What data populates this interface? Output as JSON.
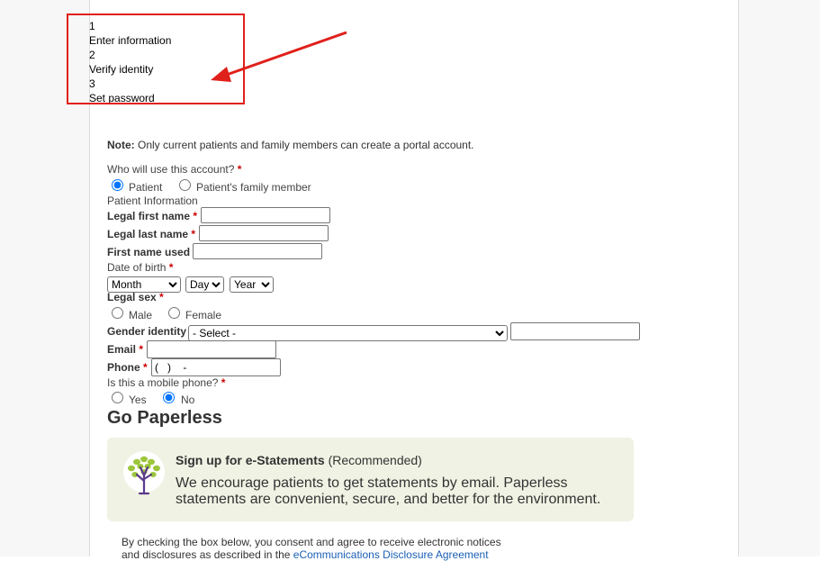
{
  "steps": [
    {
      "number": "1",
      "label": "Enter information"
    },
    {
      "number": "2",
      "label": "Verify identity"
    },
    {
      "number": "3",
      "label": "Set password"
    }
  ],
  "note": {
    "prefix": "Note:",
    "text": " Only current patients and family members can create a portal account."
  },
  "account_user": {
    "question": "Who will use this account?",
    "required_mark": "*",
    "options": [
      "Patient",
      "Patient's family member"
    ],
    "selected": "Patient"
  },
  "patient_info": {
    "heading": "Patient Information",
    "first_name_label": "Legal first name",
    "last_name_label": "Legal last name",
    "first_name_used_label": "First name used",
    "dob_label": "Date of birth",
    "dob_month": "Month",
    "dob_day": "Day",
    "dob_year": "Year",
    "sex_label": "Legal sex",
    "sex_options": [
      "Male",
      "Female"
    ],
    "gender_label": "Gender identity",
    "gender_value": "- Select -",
    "email_label": "Email",
    "phone_label": "Phone",
    "phone_value": "(   )    -",
    "mobile_question": "Is this a mobile phone?",
    "mobile_options": [
      "Yes",
      "No"
    ],
    "mobile_selected": "No",
    "required_mark": "*"
  },
  "paperless": {
    "heading": "Go Paperless",
    "promo_title_bold": "Sign up for e-Statements",
    "promo_title_rest": " (Recommended)",
    "promo_body": "We encourage patients to get statements by email. Paperless statements are convenient, secure, and better for the environment.",
    "icon": "tree-icon"
  },
  "consent": {
    "text": "By checking the box below, you consent and agree to receive electronic notices and disclosures as described in the ",
    "link_text": "eCommunications Disclosure Agreement"
  },
  "colors": {
    "annotation_red": "#e0201b",
    "promo_bg": "#f0f2e4",
    "required": "#cc0000",
    "link": "#1a5fb4"
  }
}
